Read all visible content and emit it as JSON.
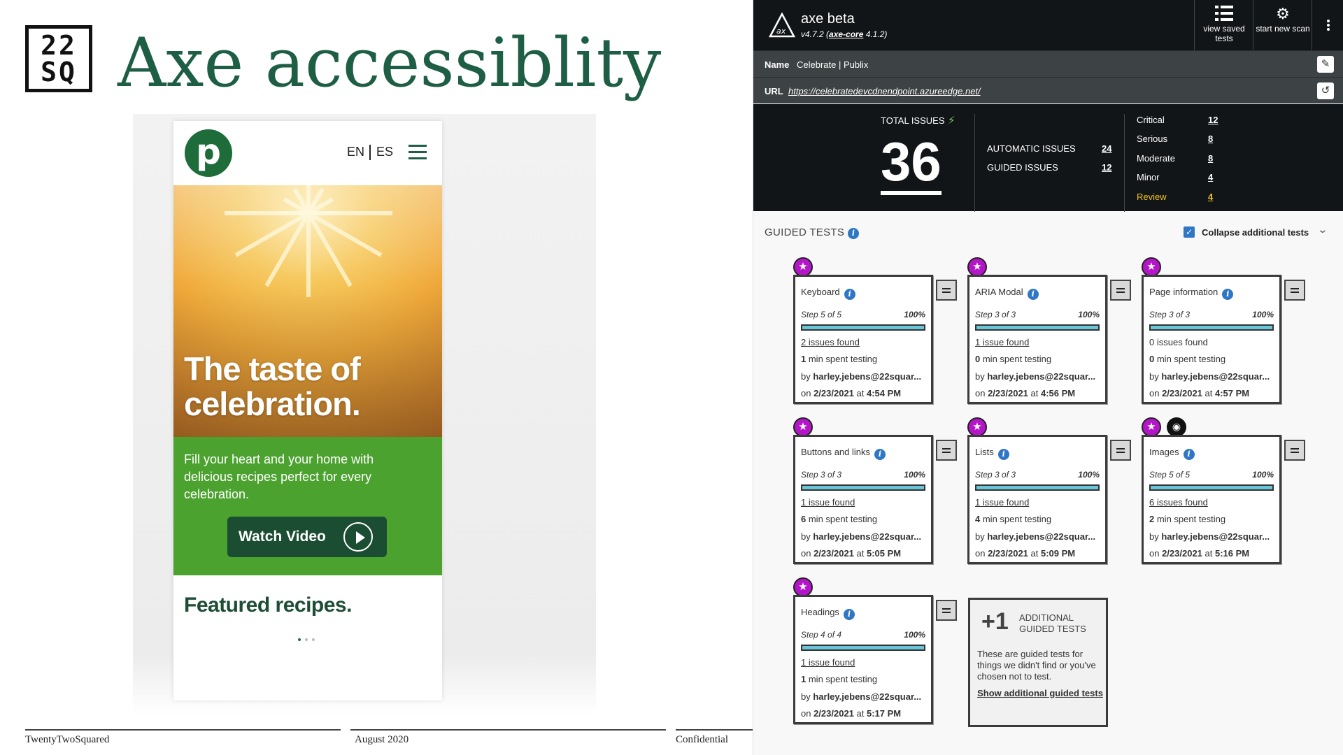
{
  "slide": {
    "logo_top": "22",
    "logo_bottom": "SQ",
    "title": "Axe accessiblity",
    "footer": {
      "left": "TwentyTwoSquared",
      "center": "August 2020",
      "right": "Confidential"
    }
  },
  "phone": {
    "logo_letter": "p",
    "lang_en": "EN",
    "lang_es": "ES",
    "hero_title": "The taste of celebration.",
    "hero_text": "Fill your heart and your home with delicious recipes perfect for every celebration.",
    "watch_video": "Watch Video",
    "featured": "Featured recipes.",
    "carousel": {
      "total": 3,
      "active": 1
    }
  },
  "axe": {
    "app_name": "axe beta",
    "version": "v4.7.2 (",
    "core_link": "axe-core",
    "core_version": " 4.1.2)",
    "btn_saved": "view saved tests",
    "btn_new": "start new scan",
    "name_label": "Name",
    "name_value": "Celebrate | Publix",
    "url_label": "URL",
    "url_value": "https://celebratedevcdnendpoint.azureedge.net/",
    "summary": {
      "total_label": "TOTAL ISSUES",
      "total": "36",
      "automatic_label": "AUTOMATIC ISSUES",
      "automatic": "24",
      "guided_label": "GUIDED ISSUES",
      "guided": "12",
      "severity": [
        {
          "label": "Critical",
          "value": "12"
        },
        {
          "label": "Serious",
          "value": "8"
        },
        {
          "label": "Moderate",
          "value": "8"
        },
        {
          "label": "Minor",
          "value": "4"
        },
        {
          "label": "Review",
          "value": "4"
        }
      ]
    },
    "guided_header": "GUIDED TESTS",
    "collapse_label": "Collapse additional tests",
    "collapse_checked": true,
    "cards": [
      {
        "title": "Keyboard",
        "step": "Step 5 of 5",
        "pct": "100%",
        "progress": 1.0,
        "issues": "2 issues found",
        "min": "1",
        "min_text": " min spent testing",
        "by": "by ",
        "user": "harley.jebens@22squar...",
        "on": "on ",
        "date": "2/23/2021",
        "at": " at ",
        "time": "4:54 PM"
      },
      {
        "title": "ARIA Modal",
        "step": "Step 3 of 3",
        "pct": "100%",
        "progress": 1.0,
        "issues": "1 issue found",
        "min": "0",
        "min_text": " min spent testing",
        "by": "by ",
        "user": "harley.jebens@22squar...",
        "on": "on ",
        "date": "2/23/2021",
        "at": " at ",
        "time": "4:56 PM"
      },
      {
        "title": "Page information",
        "step": "Step 3 of 3",
        "pct": "100%",
        "progress": 1.0,
        "issues": "0 issues found",
        "min": "0",
        "min_text": " min spent testing",
        "by": "by ",
        "user": "harley.jebens@22squar...",
        "on": "on ",
        "date": "2/23/2021",
        "at": " at ",
        "time": "4:57 PM"
      },
      {
        "title": "Buttons and links",
        "step": "Step 3 of 3",
        "pct": "100%",
        "progress": 1.0,
        "issues": "1 issue found",
        "min": "6",
        "min_text": " min spent testing",
        "by": "by ",
        "user": "harley.jebens@22squar...",
        "on": "on ",
        "date": "2/23/2021",
        "at": " at ",
        "time": "5:05 PM"
      },
      {
        "title": "Lists",
        "step": "Step 3 of 3",
        "pct": "100%",
        "progress": 1.0,
        "issues": "1 issue found",
        "min": "4",
        "min_text": " min spent testing",
        "by": "by ",
        "user": "harley.jebens@22squar...",
        "on": "on ",
        "date": "2/23/2021",
        "at": " at ",
        "time": "5:09 PM"
      },
      {
        "title": "Images",
        "step": "Step 5 of 5",
        "pct": "100%",
        "progress": 1.0,
        "issues": "6 issues found",
        "min": "2",
        "min_text": " min spent testing",
        "by": "by ",
        "user": "harley.jebens@22squar...",
        "on": "on ",
        "date": "2/23/2021",
        "at": " at ",
        "time": "5:16 PM"
      },
      {
        "title": "Headings",
        "step": "Step 4 of 4",
        "pct": "100%",
        "progress": 1.0,
        "issues": "1 issue found",
        "min": "1",
        "min_text": " min spent testing",
        "by": "by ",
        "user": "harley.jebens@22squar...",
        "on": "on ",
        "date": "2/23/2021",
        "at": " at ",
        "time": "5:17 PM"
      }
    ],
    "additional": {
      "count": "+1",
      "line1": "ADDITIONAL",
      "line2": "GUIDED TESTS",
      "desc": "These are guided tests for things we didn't find or you've chosen not to test.",
      "link": "Show additional guided tests"
    },
    "icons": {
      "star": "star-icon",
      "info": "info-icon",
      "eye": "eye-icon",
      "menu": "menu-icon",
      "edit": "edit-icon",
      "refresh": "refresh-icon",
      "bolt": "bolt-icon"
    },
    "colors": {
      "dark": "#121518",
      "star": "#b415c9",
      "progress": "#67c7d8",
      "info": "#2f77c5",
      "review": "#f0c020"
    }
  }
}
